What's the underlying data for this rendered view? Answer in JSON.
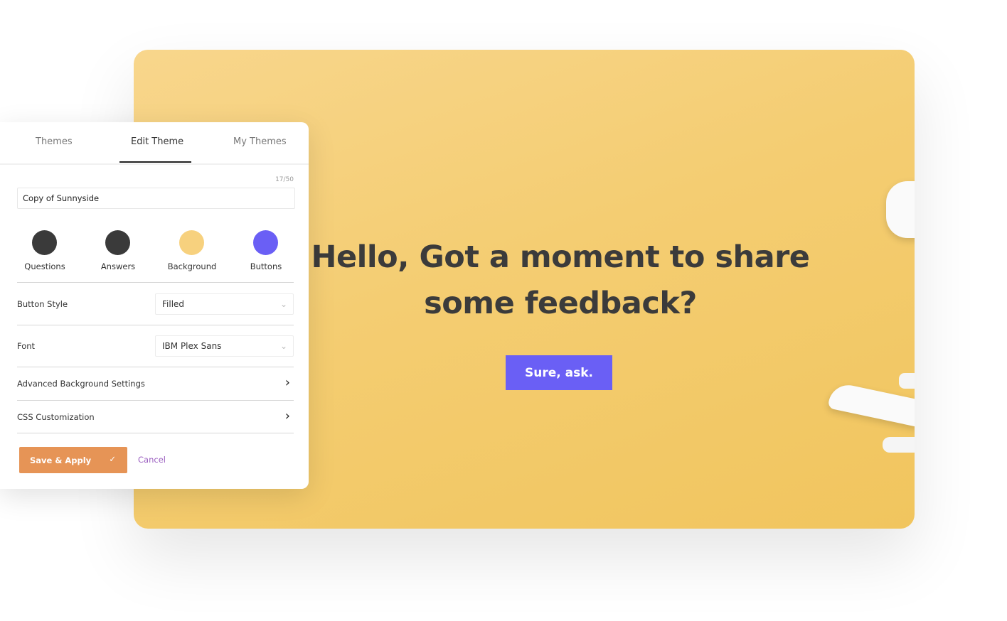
{
  "preview": {
    "headline": "Hello, Got a moment to share some feedback?",
    "cta_label": "Sure, ask.",
    "background_color": "#f4cd72",
    "button_color": "#6a5ff5"
  },
  "panel": {
    "tabs": [
      {
        "label": "Themes"
      },
      {
        "label": "Edit Theme",
        "active": true
      },
      {
        "label": "My Themes"
      }
    ],
    "name_counter": "17/50",
    "name_value": "Copy of Sunnyside",
    "colors": [
      {
        "label": "Questions",
        "color": "#3a3a3a"
      },
      {
        "label": "Answers",
        "color": "#3a3a3a"
      },
      {
        "label": "Background",
        "color": "#f7d17e"
      },
      {
        "label": "Buttons",
        "color": "#6a5ff5"
      }
    ],
    "button_style": {
      "label": "Button Style",
      "value": "Filled"
    },
    "font": {
      "label": "Font",
      "value": "IBM Plex Sans"
    },
    "advanced_bg": "Advanced Background Settings",
    "css_custom": "CSS Customization",
    "save_label": "Save & Apply",
    "cancel_label": "Cancel",
    "icons": {
      "check": "check-icon",
      "chevron_down": "chevron-down-icon",
      "chevron_right": "chevron-right-icon"
    }
  }
}
